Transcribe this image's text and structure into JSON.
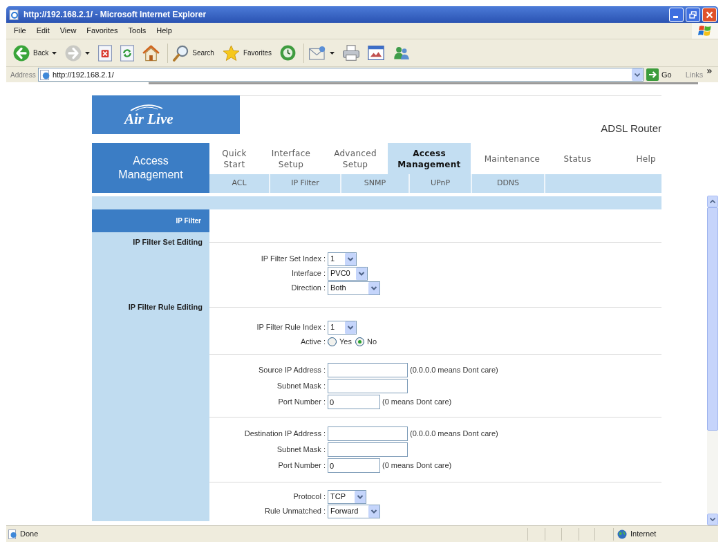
{
  "window": {
    "title": "http://192.168.2.1/ - Microsoft Internet Explorer"
  },
  "menu_bar": [
    "File",
    "Edit",
    "View",
    "Favorites",
    "Tools",
    "Help"
  ],
  "toolbar": [
    {
      "kind": "back",
      "label": "Back"
    },
    {
      "kind": "forward"
    },
    {
      "kind": "stop"
    },
    {
      "kind": "refresh"
    },
    {
      "kind": "home"
    },
    {
      "kind": "search",
      "label": "Search"
    },
    {
      "kind": "favorites",
      "label": "Favorites"
    },
    {
      "kind": "history"
    },
    {
      "kind": "mail"
    },
    {
      "kind": "print"
    },
    {
      "kind": "edit"
    },
    {
      "kind": "messenger"
    }
  ],
  "address_bar": {
    "label": "Address",
    "value": "http://192.168.2.1/",
    "go": "Go",
    "links": "Links"
  },
  "page": {
    "logo": "Air Live",
    "product": "ADSL Router",
    "section": "Access Management",
    "tabs": [
      {
        "label": "Quick Start",
        "selected": false
      },
      {
        "label": "Interface Setup",
        "selected": false
      },
      {
        "label": "Advanced Setup",
        "selected": false
      },
      {
        "label": "Access Management",
        "selected": true
      },
      {
        "label": "Maintenance",
        "selected": false
      },
      {
        "label": "Status",
        "selected": false
      },
      {
        "label": "Help",
        "selected": false
      }
    ],
    "subtabs": [
      "ACL",
      "IP Filter",
      "SNMP",
      "UPnP",
      "DDNS"
    ],
    "sidebar_heading": "IP Filter",
    "groups": [
      {
        "section": "IP Filter Set Editing",
        "fields": [
          {
            "kind": "select",
            "label": "IP Filter Set Index :",
            "value": "1"
          },
          {
            "kind": "select",
            "label": "Interface :",
            "value": "PVC0"
          },
          {
            "kind": "select",
            "label": "Direction :",
            "value": "Both"
          }
        ]
      },
      {
        "section": "IP Filter Rule Editing",
        "fields": [
          {
            "kind": "select",
            "label": "IP Filter Rule Index :",
            "value": "1"
          },
          {
            "kind": "radio",
            "label": "Active :",
            "options": [
              {
                "label": "Yes",
                "selected": false
              },
              {
                "label": "No",
                "selected": true
              }
            ]
          }
        ]
      },
      {
        "fields": [
          {
            "kind": "text",
            "label": "Source IP Address :",
            "hint": "(0.0.0.0 means Dont care)"
          },
          {
            "kind": "text",
            "label": "Subnet Mask :"
          },
          {
            "kind": "text",
            "label": "Port Number :",
            "value": "0",
            "hint": "(0 means Dont care)"
          }
        ]
      },
      {
        "fields": [
          {
            "kind": "text",
            "label": "Destination IP Address :",
            "hint": "(0.0.0.0 means Dont care)"
          },
          {
            "kind": "text",
            "label": "Subnet Mask :"
          },
          {
            "kind": "text",
            "label": "Port Number :",
            "value": "0",
            "hint": "(0 means Dont care)"
          }
        ]
      },
      {
        "fields": [
          {
            "kind": "select",
            "label": "Protocol :",
            "value": "TCP"
          },
          {
            "kind": "select",
            "label": "Rule Unmatched :",
            "value": "Forward"
          }
        ]
      }
    ]
  },
  "status_bar": {
    "text": "Done",
    "zone": "Internet"
  }
}
